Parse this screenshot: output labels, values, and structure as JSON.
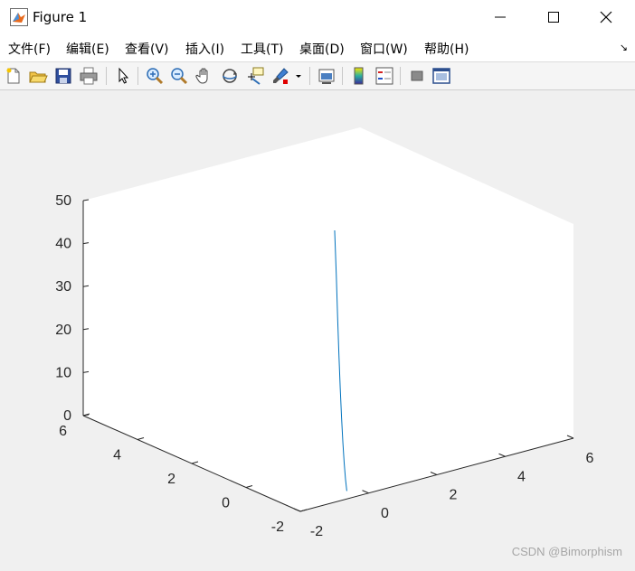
{
  "window": {
    "title": "Figure 1"
  },
  "menu": {
    "items": [
      {
        "label": "文件(F)"
      },
      {
        "label": "编辑(E)"
      },
      {
        "label": "查看(V)"
      },
      {
        "label": "插入(I)"
      },
      {
        "label": "工具(T)"
      },
      {
        "label": "桌面(D)"
      },
      {
        "label": "窗口(W)"
      },
      {
        "label": "帮助(H)"
      }
    ]
  },
  "toolbar": {
    "icons": [
      "new-figure-icon",
      "open-icon",
      "save-icon",
      "print-icon",
      "select-arrow-icon",
      "zoom-in-icon",
      "zoom-out-icon",
      "pan-hand-icon",
      "rotate-3d-icon",
      "data-cursor-icon",
      "brush-icon",
      "brush-dropdown-icon",
      "link-plot-icon",
      "colorbar-icon",
      "legend-icon",
      "hide-plot-tools-icon",
      "show-plot-tools-icon"
    ]
  },
  "chart_data": {
    "type": "line",
    "projection": "3d",
    "title": "",
    "xlabel": "",
    "ylabel": "",
    "zlabel": "",
    "xlim": [
      -2,
      6
    ],
    "ylim": [
      -2,
      6
    ],
    "zlim": [
      0,
      50
    ],
    "xticks": [
      "-2",
      "0",
      "2",
      "4",
      "6"
    ],
    "yticks": [
      "-2",
      "0",
      "2",
      "4",
      "6"
    ],
    "zticks": [
      "0",
      "10",
      "20",
      "30",
      "40",
      "50"
    ],
    "grid": false,
    "series": [
      {
        "color": "#0072bd",
        "points": [
          {
            "x": -0.4,
            "y": -1.7,
            "z": 0.5
          },
          {
            "x": -0.2,
            "y": -1.4,
            "z": 2.0
          },
          {
            "x": 0.0,
            "y": -1.1,
            "z": 4.5
          },
          {
            "x": 0.2,
            "y": -0.8,
            "z": 8.0
          },
          {
            "x": 0.4,
            "y": -0.5,
            "z": 12.5
          },
          {
            "x": 0.6,
            "y": -0.2,
            "z": 18.0
          },
          {
            "x": 0.8,
            "y": 0.1,
            "z": 24.5
          },
          {
            "x": 1.0,
            "y": 0.4,
            "z": 32.0
          },
          {
            "x": 1.2,
            "y": 0.7,
            "z": 40.5
          },
          {
            "x": 1.35,
            "y": 0.95,
            "z": 50.0
          }
        ]
      }
    ]
  },
  "watermark": "CSDN @Bimorphism"
}
